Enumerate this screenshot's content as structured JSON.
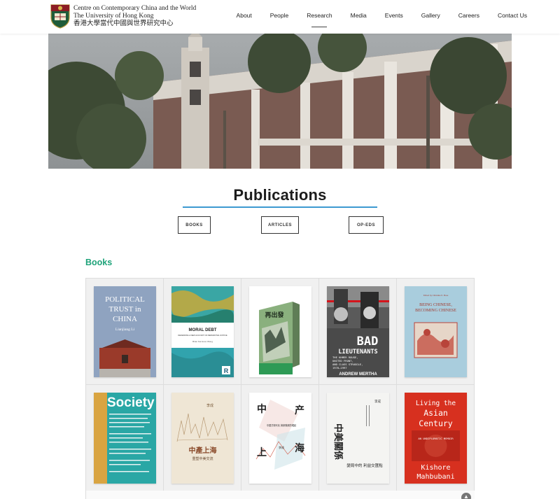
{
  "header": {
    "org_line1": "Centre on Contemporary China and the World",
    "org_line2": "The University of Hong Kong",
    "org_line3": "香港大學當代中國與世界研究中心",
    "nav": [
      "About",
      "People",
      "Research",
      "Media",
      "Events",
      "Gallery",
      "Careers",
      "Contact Us"
    ],
    "active_nav": "Research"
  },
  "page": {
    "title": "Publications",
    "tabs": [
      "BOOKS",
      "ARTICLES",
      "OP-EDS"
    ],
    "section_heading": "Books"
  },
  "books": [
    {
      "title_lines": [
        "POLITICAL",
        "TRUST in",
        "CHINA"
      ],
      "author": "Lianjiang Li"
    },
    {
      "title_lines": [
        "MORAL DEBT"
      ],
      "subtitle": "DEFENDING A NEW ACCOUNT OF REPARATIVE JUSTICE",
      "author": "Brian Kai Hoon Wong"
    },
    {
      "title_lines": [
        "再出發"
      ]
    },
    {
      "title_lines": [
        "BAD",
        "LIEUTENANTS"
      ],
      "subtitle_lines": [
        "THE KHMER ROUGE,",
        "UNITED FRONT,",
        "AND CLASS STRUGGLE,",
        "1970–1997"
      ],
      "author": "ANDREW MERTHA"
    },
    {
      "title_lines": [
        "BEING CHINESE,",
        "BECOMING CHINESE"
      ],
      "editor": "Edited by Christine E. Bose"
    },
    {
      "title_lines": [
        "Society"
      ]
    },
    {
      "title_lines": [
        "中產上海"
      ],
      "subtitle": "重塑中美交流",
      "author": "李成"
    },
    {
      "title_lines": [
        "中",
        "产",
        "上",
        "海"
      ],
      "subtitle": "中國式現代化 與新階層的崛起",
      "author": "李成"
    },
    {
      "title_lines": [
        "中美關係"
      ],
      "subtitle": "變局中的 利益交匯點",
      "author": "李成"
    },
    {
      "title_lines": [
        "Living the",
        "Asian",
        "Century"
      ],
      "subtitle": "AN UNDIPLOMATIC MEMOIR",
      "author_lines": [
        "Kishore",
        "Mahbubani"
      ]
    }
  ],
  "colors": {
    "accent_green": "#1fa37a",
    "underline_blue": "#3d9ad1"
  }
}
